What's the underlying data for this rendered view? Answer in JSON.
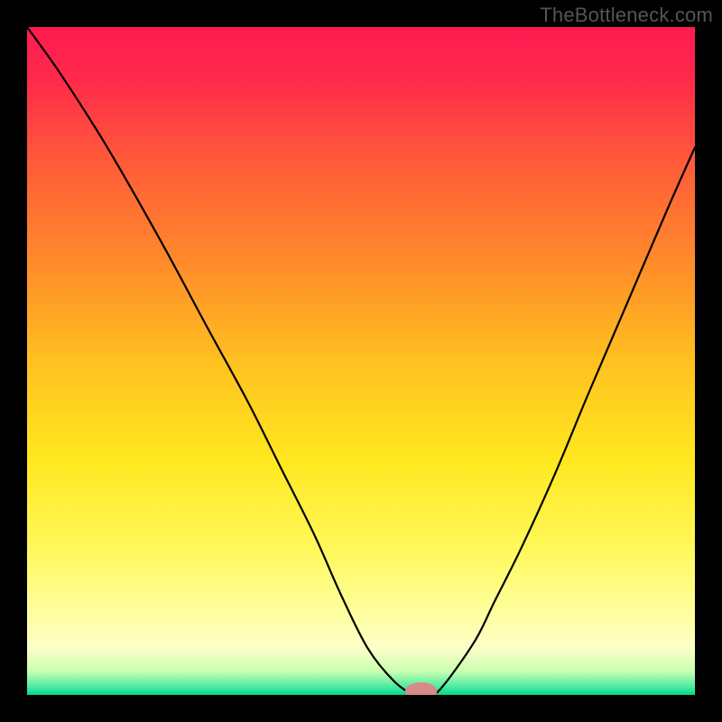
{
  "watermark": "TheBottleneck.com",
  "chart_data": {
    "type": "line",
    "title": "",
    "xlabel": "",
    "ylabel": "",
    "xlim": [
      0,
      100
    ],
    "ylim": [
      0,
      100
    ],
    "background_gradient": {
      "stops": [
        {
          "pos": 0.0,
          "color": "#ff1a52"
        },
        {
          "pos": 0.08,
          "color": "#ff2a4a"
        },
        {
          "pos": 0.2,
          "color": "#ff5a3a"
        },
        {
          "pos": 0.35,
          "color": "#ff8a2a"
        },
        {
          "pos": 0.5,
          "color": "#ffc020"
        },
        {
          "pos": 0.65,
          "color": "#ffe820"
        },
        {
          "pos": 0.78,
          "color": "#fff85a"
        },
        {
          "pos": 0.88,
          "color": "#ffffa0"
        },
        {
          "pos": 0.93,
          "color": "#fdffc8"
        },
        {
          "pos": 0.965,
          "color": "#c8ffb0"
        },
        {
          "pos": 0.99,
          "color": "#40e8a0"
        },
        {
          "pos": 1.0,
          "color": "#00d884"
        }
      ]
    },
    "series": [
      {
        "name": "bottleneck-curve",
        "color": "#000000",
        "x": [
          0,
          5,
          12,
          20,
          27,
          33,
          38,
          43,
          47,
          51,
          55,
          58,
          60,
          62,
          67,
          70,
          74,
          79,
          84,
          90,
          96,
          100
        ],
        "y": [
          100,
          93,
          82,
          68,
          55,
          44,
          34,
          24,
          15,
          7,
          2,
          0,
          0,
          1,
          8,
          14,
          22,
          33,
          45,
          59,
          73,
          82
        ]
      }
    ],
    "marker": {
      "name": "minimum-marker",
      "cx": 59,
      "cy": 0.5,
      "rx": 2.4,
      "ry": 1.4,
      "color": "#d88a88"
    }
  }
}
